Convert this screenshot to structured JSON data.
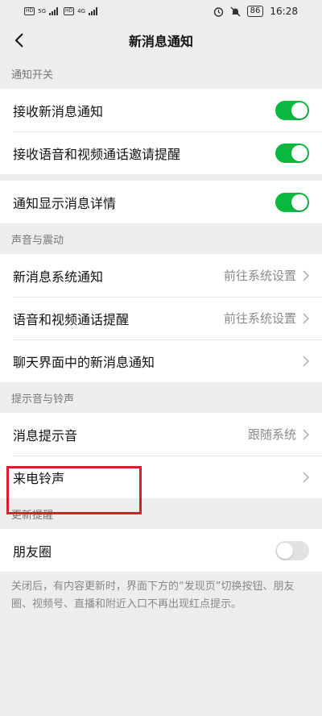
{
  "status_bar": {
    "left_labels": [
      "HD",
      "5G",
      "HD",
      "4G"
    ],
    "battery": "86",
    "time": "16:28"
  },
  "nav": {
    "title": "新消息通知"
  },
  "sections": {
    "notify_switch": {
      "header": "通知开关",
      "rows": [
        {
          "label": "接收新消息通知",
          "toggle": "on"
        },
        {
          "label": "接收语音和视频通话邀请提醒",
          "toggle": "on"
        }
      ],
      "detail_row": {
        "label": "通知显示消息详情",
        "toggle": "on"
      }
    },
    "sound_vibration": {
      "header": "声音与震动",
      "rows": [
        {
          "label": "新消息系统通知",
          "value": "前往系统设置"
        },
        {
          "label": "语音和视频通话提醒",
          "value": "前往系统设置"
        },
        {
          "label": "聊天界面中的新消息通知",
          "value": ""
        }
      ]
    },
    "tone_ringtone": {
      "header": "提示音与铃声",
      "rows": [
        {
          "label": "消息提示音",
          "value": "跟随系统"
        },
        {
          "label": "来电铃声",
          "value": ""
        }
      ]
    },
    "updates": {
      "header": "更新提醒",
      "rows": [
        {
          "label": "朋友圈",
          "toggle": "off"
        }
      ],
      "note": "关闭后，有内容更新时，界面下方的“发现页”切换按钮、朋友圈、视频号、直播和附近入口不再出现红点提示。"
    }
  },
  "colors": {
    "toggle_on": "#09b83e",
    "highlight": "#d81e2c"
  }
}
